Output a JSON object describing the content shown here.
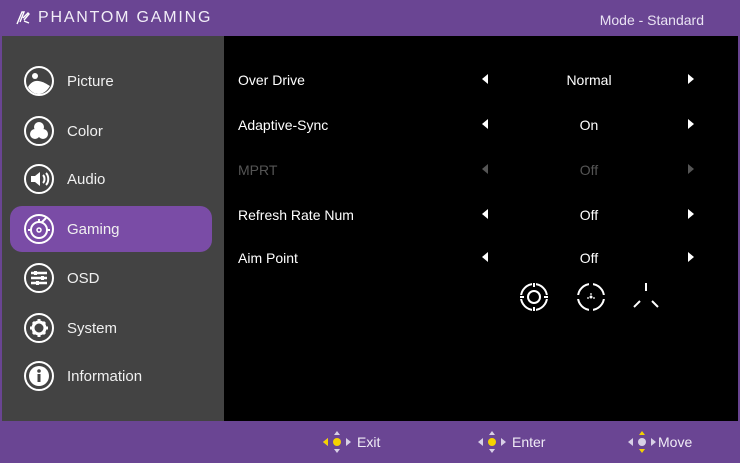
{
  "header": {
    "brand": "PHANTOM GAMING",
    "mode": "Mode - Standard"
  },
  "sidebar": {
    "items": [
      {
        "label": "Picture",
        "icon": "picture-icon"
      },
      {
        "label": "Color",
        "icon": "color-icon"
      },
      {
        "label": "Audio",
        "icon": "audio-icon"
      },
      {
        "label": "Gaming",
        "icon": "gaming-icon",
        "active": true
      },
      {
        "label": "OSD",
        "icon": "osd-icon"
      },
      {
        "label": "System",
        "icon": "system-icon"
      },
      {
        "label": "Information",
        "icon": "information-icon"
      }
    ]
  },
  "settings": [
    {
      "label": "Over Drive",
      "value": "Normal",
      "enabled": true
    },
    {
      "label": "Adaptive-Sync",
      "value": "On",
      "enabled": true
    },
    {
      "label": "MPRT",
      "value": "Off",
      "enabled": false
    },
    {
      "label": "Refresh Rate Num",
      "value": "Off",
      "enabled": true
    },
    {
      "label": "Aim Point",
      "value": "Off",
      "enabled": true
    }
  ],
  "aim_point_options": [
    "crosshair-circle-icon",
    "crosshair-dot-circle-icon",
    "crosshair-tri-icon"
  ],
  "footer": {
    "exit": "Exit",
    "enter": "Enter",
    "move": "Move"
  },
  "colors": {
    "accent": "#6a4593",
    "active_item": "#7a4ca6",
    "sidebar": "#434343",
    "dpad_highlight": "#f5d200"
  }
}
